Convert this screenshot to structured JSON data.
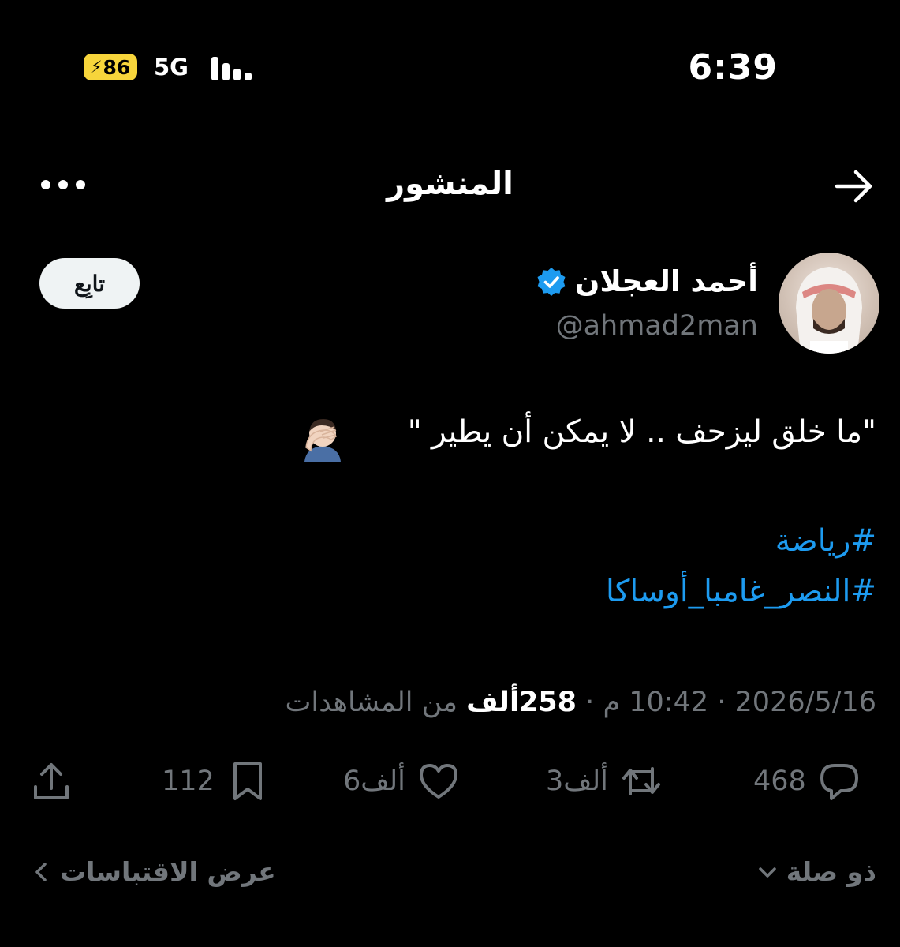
{
  "status_bar": {
    "time": "6:39",
    "battery": "86",
    "network": "5G",
    "icons": [
      "battery-charging-icon",
      "signal-icon"
    ]
  },
  "header": {
    "title": "المنشور",
    "icons": [
      "more-icon",
      "back-arrow-icon"
    ]
  },
  "author": {
    "name": "أحمد العجلان",
    "handle": "@ahmad2man",
    "follow_label": "تابِع",
    "verified_color": "#1d9bf0",
    "icons": [
      "avatar",
      "verified-badge-icon"
    ]
  },
  "tweet": {
    "text": "\"ما خلق ليزحف .. لا يمكن أن يطير \"",
    "emoji": "facepalm-emoji-icon",
    "hashtags": [
      "#رياضة",
      "#النصر_غامبا_أوساكا"
    ],
    "hashtag_color": "#1d9bf0"
  },
  "meta": {
    "date": "2026/5/16",
    "time": "10:42 م",
    "views_count": "258ألف",
    "views_label": "من المشاهدات",
    "separator": "·"
  },
  "actions": {
    "reply": {
      "count": "468",
      "icon": "reply-icon"
    },
    "retweet": {
      "count": "3ألف",
      "icon": "retweet-icon"
    },
    "like": {
      "count": "6ألف",
      "icon": "heart-icon"
    },
    "bookmark": {
      "count": "112",
      "icon": "bookmark-icon"
    },
    "share": {
      "icon": "share-icon"
    }
  },
  "footer": {
    "related_label": "ذو صلة",
    "quotes_label": "عرض الاقتباسات",
    "icons": [
      "chevron-down-icon",
      "chevron-left-icon"
    ]
  },
  "colors": {
    "background": "#000000",
    "text_primary": "#e7e9ea",
    "text_secondary": "#71767b",
    "accent": "#1d9bf0",
    "battery": "#f7d53b"
  }
}
